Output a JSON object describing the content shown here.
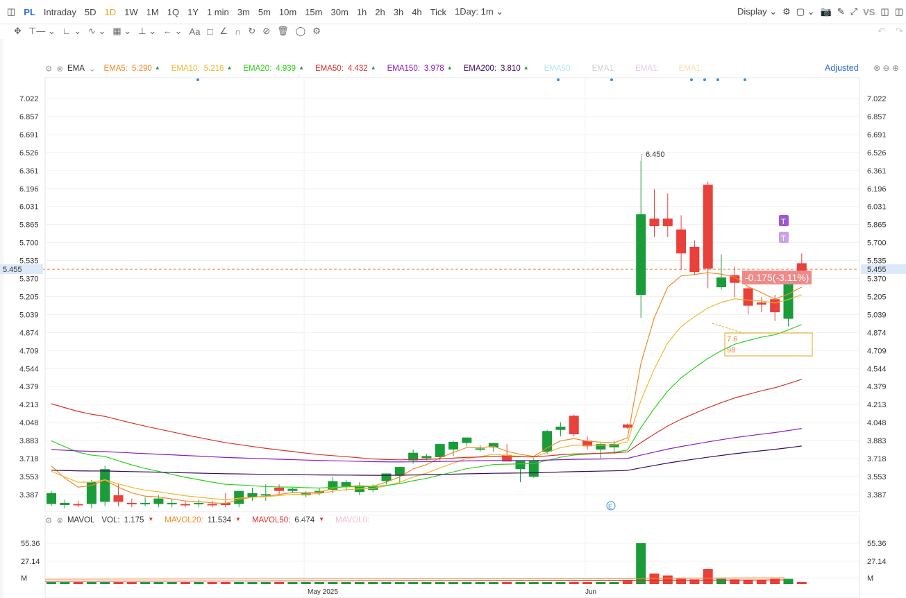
{
  "topbar": {
    "symbol": "PL",
    "periods": [
      "Intraday",
      "5D",
      "1D",
      "1W",
      "1M",
      "1Q",
      "1Y",
      "1 min",
      "3m",
      "5m",
      "10m",
      "15m",
      "30m",
      "1h",
      "2h",
      "3h",
      "4h",
      "Tick"
    ],
    "active_period": "1D",
    "interval_select": "1Day: 1m",
    "display_label": "Display",
    "vs_label": "VS"
  },
  "indicators": {
    "main_name": "EMA",
    "items": [
      {
        "label": "EMA5:",
        "value": "5.290",
        "color": "#f08a24"
      },
      {
        "label": "EMA10:",
        "value": "5.216",
        "color": "#f2b630"
      },
      {
        "label": "EMA20:",
        "value": "4.939",
        "color": "#2ad21c"
      },
      {
        "label": "EMA50:",
        "value": "4.432",
        "color": "#d9312b"
      },
      {
        "label": "EMA150:",
        "value": "3.978",
        "color": "#8a1cc4"
      },
      {
        "label": "EMA200:",
        "value": "3.810",
        "color": "#3b0a59"
      }
    ],
    "faded": [
      {
        "label": "EMA50:",
        "color": "#b8e6f2"
      },
      {
        "label": "EMA1:",
        "color": "#cfcfcf"
      },
      {
        "label": "EMA1:",
        "color": "#e6c8e6"
      },
      {
        "label": "EMA1:",
        "color": "#f5e0b0"
      }
    ],
    "adjusted_label": "Adjusted"
  },
  "volume_indicator": {
    "name": "MAVOL",
    "items": [
      {
        "label": "VOL:",
        "value": "1.175",
        "color": "#2d6ae0"
      },
      {
        "label": "MAVOL20:",
        "value": "11.534",
        "color": "#f08a24"
      },
      {
        "label": "MAVOL50:",
        "value": "6.474",
        "color": "#d9312b"
      },
      {
        "label": "MAVOL0:",
        "value": "",
        "color": "#f2c0d0"
      }
    ]
  },
  "chart_data": {
    "type": "candlestick",
    "y_ticks": [
      "7.022",
      "6.857",
      "6.691",
      "6.526",
      "6.361",
      "6.196",
      "6.031",
      "5.865",
      "5.700",
      "5.535",
      "5.370",
      "5.205",
      "5.039",
      "4.874",
      "4.709",
      "4.544",
      "4.379",
      "4.213",
      "4.048",
      "3.883",
      "3.718",
      "3.553",
      "3.387"
    ],
    "current_price": "5.455",
    "high_label": "6.450",
    "change_label": "-0.175(-3.11%)",
    "box_text": [
      "7.6",
      "98"
    ],
    "x_labels": [
      "May 2025",
      "Jun"
    ],
    "volume_ticks": [
      "55.36",
      "27.14",
      "M"
    ],
    "candles": [
      {
        "o": 3.3,
        "h": 3.42,
        "l": 3.28,
        "c": 3.4
      },
      {
        "o": 3.29,
        "h": 3.34,
        "l": 3.26,
        "c": 3.31
      },
      {
        "o": 3.3,
        "h": 3.33,
        "l": 3.27,
        "c": 3.29
      },
      {
        "o": 3.3,
        "h": 3.52,
        "l": 3.26,
        "c": 3.5
      },
      {
        "o": 3.32,
        "h": 3.65,
        "l": 3.28,
        "c": 3.62
      },
      {
        "o": 3.38,
        "h": 3.48,
        "l": 3.28,
        "c": 3.32
      },
      {
        "o": 3.31,
        "h": 3.35,
        "l": 3.27,
        "c": 3.3
      },
      {
        "o": 3.3,
        "h": 3.36,
        "l": 3.28,
        "c": 3.31
      },
      {
        "o": 3.3,
        "h": 3.38,
        "l": 3.27,
        "c": 3.35
      },
      {
        "o": 3.3,
        "h": 3.34,
        "l": 3.27,
        "c": 3.31
      },
      {
        "o": 3.3,
        "h": 3.33,
        "l": 3.27,
        "c": 3.29
      },
      {
        "o": 3.3,
        "h": 3.34,
        "l": 3.27,
        "c": 3.31
      },
      {
        "o": 3.3,
        "h": 3.33,
        "l": 3.27,
        "c": 3.29
      },
      {
        "o": 3.31,
        "h": 3.4,
        "l": 3.27,
        "c": 3.29
      },
      {
        "o": 3.3,
        "h": 3.4,
        "l": 3.27,
        "c": 3.42
      },
      {
        "o": 3.36,
        "h": 3.45,
        "l": 3.33,
        "c": 3.4
      },
      {
        "o": 3.38,
        "h": 3.48,
        "l": 3.33,
        "c": 3.39
      },
      {
        "o": 3.45,
        "h": 3.48,
        "l": 3.39,
        "c": 3.42
      },
      {
        "o": 3.42,
        "h": 3.45,
        "l": 3.4,
        "c": 3.44
      },
      {
        "o": 3.38,
        "h": 3.42,
        "l": 3.36,
        "c": 3.4
      },
      {
        "o": 3.4,
        "h": 3.45,
        "l": 3.38,
        "c": 3.42
      },
      {
        "o": 3.43,
        "h": 3.55,
        "l": 3.4,
        "c": 3.51
      },
      {
        "o": 3.46,
        "h": 3.52,
        "l": 3.42,
        "c": 3.5
      },
      {
        "o": 3.41,
        "h": 3.5,
        "l": 3.38,
        "c": 3.47
      },
      {
        "o": 3.43,
        "h": 3.48,
        "l": 3.41,
        "c": 3.46
      },
      {
        "o": 3.51,
        "h": 3.58,
        "l": 3.48,
        "c": 3.58
      },
      {
        "o": 3.56,
        "h": 3.62,
        "l": 3.49,
        "c": 3.64
      },
      {
        "o": 3.7,
        "h": 3.8,
        "l": 3.67,
        "c": 3.77
      },
      {
        "o": 3.72,
        "h": 3.76,
        "l": 3.7,
        "c": 3.74
      },
      {
        "o": 3.73,
        "h": 3.85,
        "l": 3.7,
        "c": 3.85
      },
      {
        "o": 3.8,
        "h": 3.88,
        "l": 3.74,
        "c": 3.87
      },
      {
        "o": 3.86,
        "h": 3.9,
        "l": 3.83,
        "c": 3.91
      },
      {
        "o": 3.8,
        "h": 3.84,
        "l": 3.78,
        "c": 3.81
      },
      {
        "o": 3.82,
        "h": 3.86,
        "l": 3.78,
        "c": 3.86
      },
      {
        "o": 3.75,
        "h": 3.85,
        "l": 3.7,
        "c": 3.69
      },
      {
        "o": 3.62,
        "h": 3.7,
        "l": 3.5,
        "c": 3.7
      },
      {
        "o": 3.55,
        "h": 3.72,
        "l": 3.54,
        "c": 3.7
      },
      {
        "o": 3.78,
        "h": 3.98,
        "l": 3.76,
        "c": 3.97
      },
      {
        "o": 3.98,
        "h": 4.05,
        "l": 3.92,
        "c": 4.01
      },
      {
        "o": 4.11,
        "h": 4.12,
        "l": 3.92,
        "c": 3.94
      },
      {
        "o": 3.88,
        "h": 3.92,
        "l": 3.8,
        "c": 3.83
      },
      {
        "o": 3.8,
        "h": 3.86,
        "l": 3.72,
        "c": 3.85
      },
      {
        "o": 3.82,
        "h": 3.88,
        "l": 3.76,
        "c": 3.85
      },
      {
        "o": 4.03,
        "h": 4.04,
        "l": 3.99,
        "c": 4.0
      },
      {
        "o": 5.22,
        "h": 6.45,
        "l": 5.01,
        "c": 5.96
      },
      {
        "o": 5.92,
        "h": 6.19,
        "l": 5.75,
        "c": 5.85
      },
      {
        "o": 5.92,
        "h": 6.15,
        "l": 5.75,
        "c": 5.85
      },
      {
        "o": 5.82,
        "h": 5.95,
        "l": 5.45,
        "c": 5.6
      },
      {
        "o": 5.66,
        "h": 5.72,
        "l": 5.4,
        "c": 5.43
      },
      {
        "o": 6.23,
        "h": 6.26,
        "l": 5.28,
        "c": 5.46
      },
      {
        "o": 5.29,
        "h": 5.59,
        "l": 5.27,
        "c": 5.38
      },
      {
        "o": 5.4,
        "h": 5.48,
        "l": 5.2,
        "c": 5.33
      },
      {
        "o": 5.28,
        "h": 5.3,
        "l": 5.04,
        "c": 5.12
      },
      {
        "o": 5.15,
        "h": 5.2,
        "l": 5.06,
        "c": 5.13
      },
      {
        "o": 5.18,
        "h": 5.22,
        "l": 4.98,
        "c": 5.06
      },
      {
        "o": 5.0,
        "h": 5.35,
        "l": 4.93,
        "c": 5.32
      },
      {
        "o": 5.51,
        "h": 5.6,
        "l": 5.45,
        "c": 5.42
      }
    ],
    "ema_series": [
      {
        "name": "EMA5",
        "values": [
          3.65,
          3.52,
          3.45,
          3.38,
          3.3
        ]
      },
      {
        "name": "EMA200",
        "values": [
          3.59,
          3.55,
          3.53,
          3.54,
          3.55,
          3.59,
          3.59,
          3.62,
          3.66,
          3.69,
          3.8
        ]
      }
    ]
  }
}
